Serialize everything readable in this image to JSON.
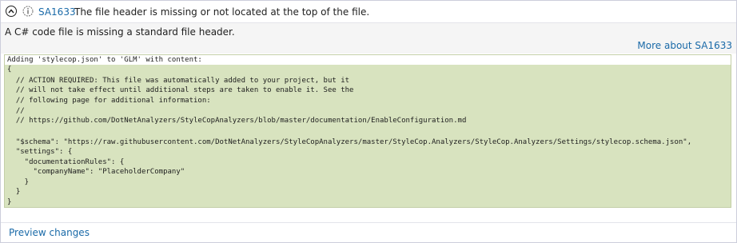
{
  "header": {
    "collapse_icon": "chevron-up-circle-icon",
    "info_icon": "info-circle-icon",
    "rule_id": "SA1633",
    "rule_title": "The file header is missing or not located at the top of the file."
  },
  "description": "A C# code file is missing a standard file header.",
  "more_link": "More about SA1633",
  "preview": {
    "intro": "Adding 'stylecop.json' to 'GLM' with content:",
    "lines": [
      "{",
      "  // ACTION REQUIRED: This file was automatically added to your project, but it",
      "  // will not take effect until additional steps are taken to enable it. See the",
      "  // following page for additional information:",
      "  //",
      "  // https://github.com/DotNetAnalyzers/StyleCopAnalyzers/blob/master/documentation/EnableConfiguration.md",
      "",
      "  \"$schema\": \"https://raw.githubusercontent.com/DotNetAnalyzers/StyleCopAnalyzers/master/StyleCop.Analyzers/StyleCop.Analyzers/Settings/stylecop.schema.json\",",
      "  \"settings\": {",
      "    \"documentationRules\": {",
      "      \"companyName\": \"PlaceholderCompany\"",
      "    }",
      "  }",
      "}"
    ]
  },
  "footer": {
    "preview_link": "Preview changes"
  },
  "colors": {
    "link": "#1a6aa8",
    "preview_background": "#d8e3bf",
    "description_background": "#f5f5f5"
  }
}
